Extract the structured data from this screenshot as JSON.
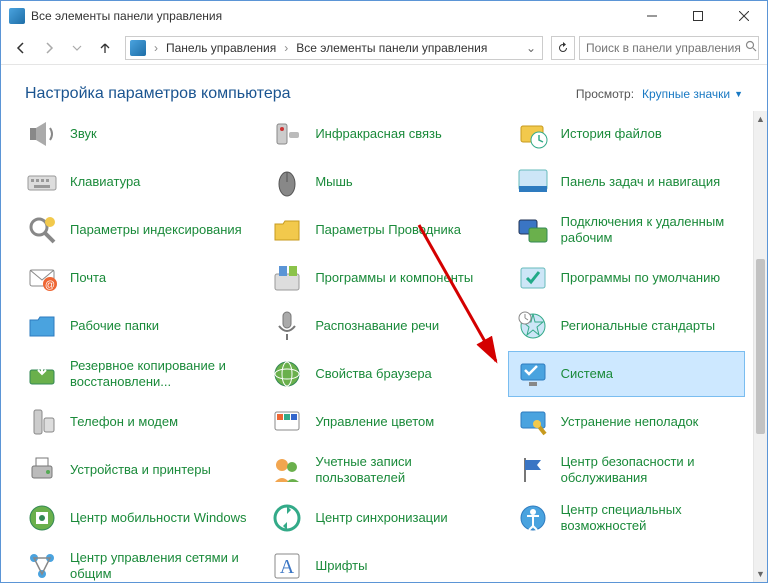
{
  "window": {
    "title": "Все элементы панели управления"
  },
  "breadcrumb": {
    "part1": "Панель управления",
    "part2": "Все элементы панели управления"
  },
  "search": {
    "placeholder": "Поиск в панели управления"
  },
  "header": {
    "title": "Настройка параметров компьютера",
    "view_label": "Просмотр:",
    "view_value": "Крупные значки"
  },
  "items": [
    {
      "id": "sound",
      "label": "Звук",
      "icon": "speaker"
    },
    {
      "id": "infrared",
      "label": "Инфракрасная связь",
      "icon": "infrared"
    },
    {
      "id": "filehistory",
      "label": "История файлов",
      "icon": "clock-folder"
    },
    {
      "id": "keyboard",
      "label": "Клавиатура",
      "icon": "keyboard"
    },
    {
      "id": "mouse",
      "label": "Мышь",
      "icon": "mouse"
    },
    {
      "id": "taskbar",
      "label": "Панель задач и навигация",
      "icon": "taskbar"
    },
    {
      "id": "indexing",
      "label": "Параметры индексирования",
      "icon": "search-opts"
    },
    {
      "id": "explorer",
      "label": "Параметры Проводника",
      "icon": "folder"
    },
    {
      "id": "remote",
      "label": "Подключения к удаленным рабочим",
      "icon": "remote"
    },
    {
      "id": "mail",
      "label": "Почта",
      "icon": "mail"
    },
    {
      "id": "programs",
      "label": "Программы и компоненты",
      "icon": "programs"
    },
    {
      "id": "defaults",
      "label": "Программы по умолчанию",
      "icon": "defaults"
    },
    {
      "id": "workfolders",
      "label": "Рабочие папки",
      "icon": "workfolder"
    },
    {
      "id": "speech",
      "label": "Распознавание речи",
      "icon": "mic"
    },
    {
      "id": "region",
      "label": "Региональные стандарты",
      "icon": "region"
    },
    {
      "id": "backup",
      "label": "Резервное копирование и восстановлени...",
      "icon": "backup"
    },
    {
      "id": "internet",
      "label": "Свойства браузера",
      "icon": "globe"
    },
    {
      "id": "system",
      "label": "Система",
      "icon": "monitor",
      "highlighted": true
    },
    {
      "id": "phone",
      "label": "Телефон и модем",
      "icon": "phone"
    },
    {
      "id": "color",
      "label": "Управление цветом",
      "icon": "color"
    },
    {
      "id": "troubleshoot",
      "label": "Устранение неполадок",
      "icon": "troubleshoot"
    },
    {
      "id": "devices",
      "label": "Устройства и принтеры",
      "icon": "printer"
    },
    {
      "id": "users",
      "label": "Учетные записи пользователей",
      "icon": "users"
    },
    {
      "id": "security",
      "label": "Центр безопасности и обслуживания",
      "icon": "flag"
    },
    {
      "id": "mobility",
      "label": "Центр мобильности Windows",
      "icon": "mobility"
    },
    {
      "id": "sync",
      "label": "Центр синхронизации",
      "icon": "sync"
    },
    {
      "id": "ease",
      "label": "Центр специальных возможностей",
      "icon": "ease"
    },
    {
      "id": "network",
      "label": "Центр управления сетями и общим",
      "icon": "network"
    },
    {
      "id": "fonts",
      "label": "Шрифты",
      "icon": "fonts"
    },
    {
      "id": "",
      "label": "",
      "icon": "blank"
    }
  ]
}
